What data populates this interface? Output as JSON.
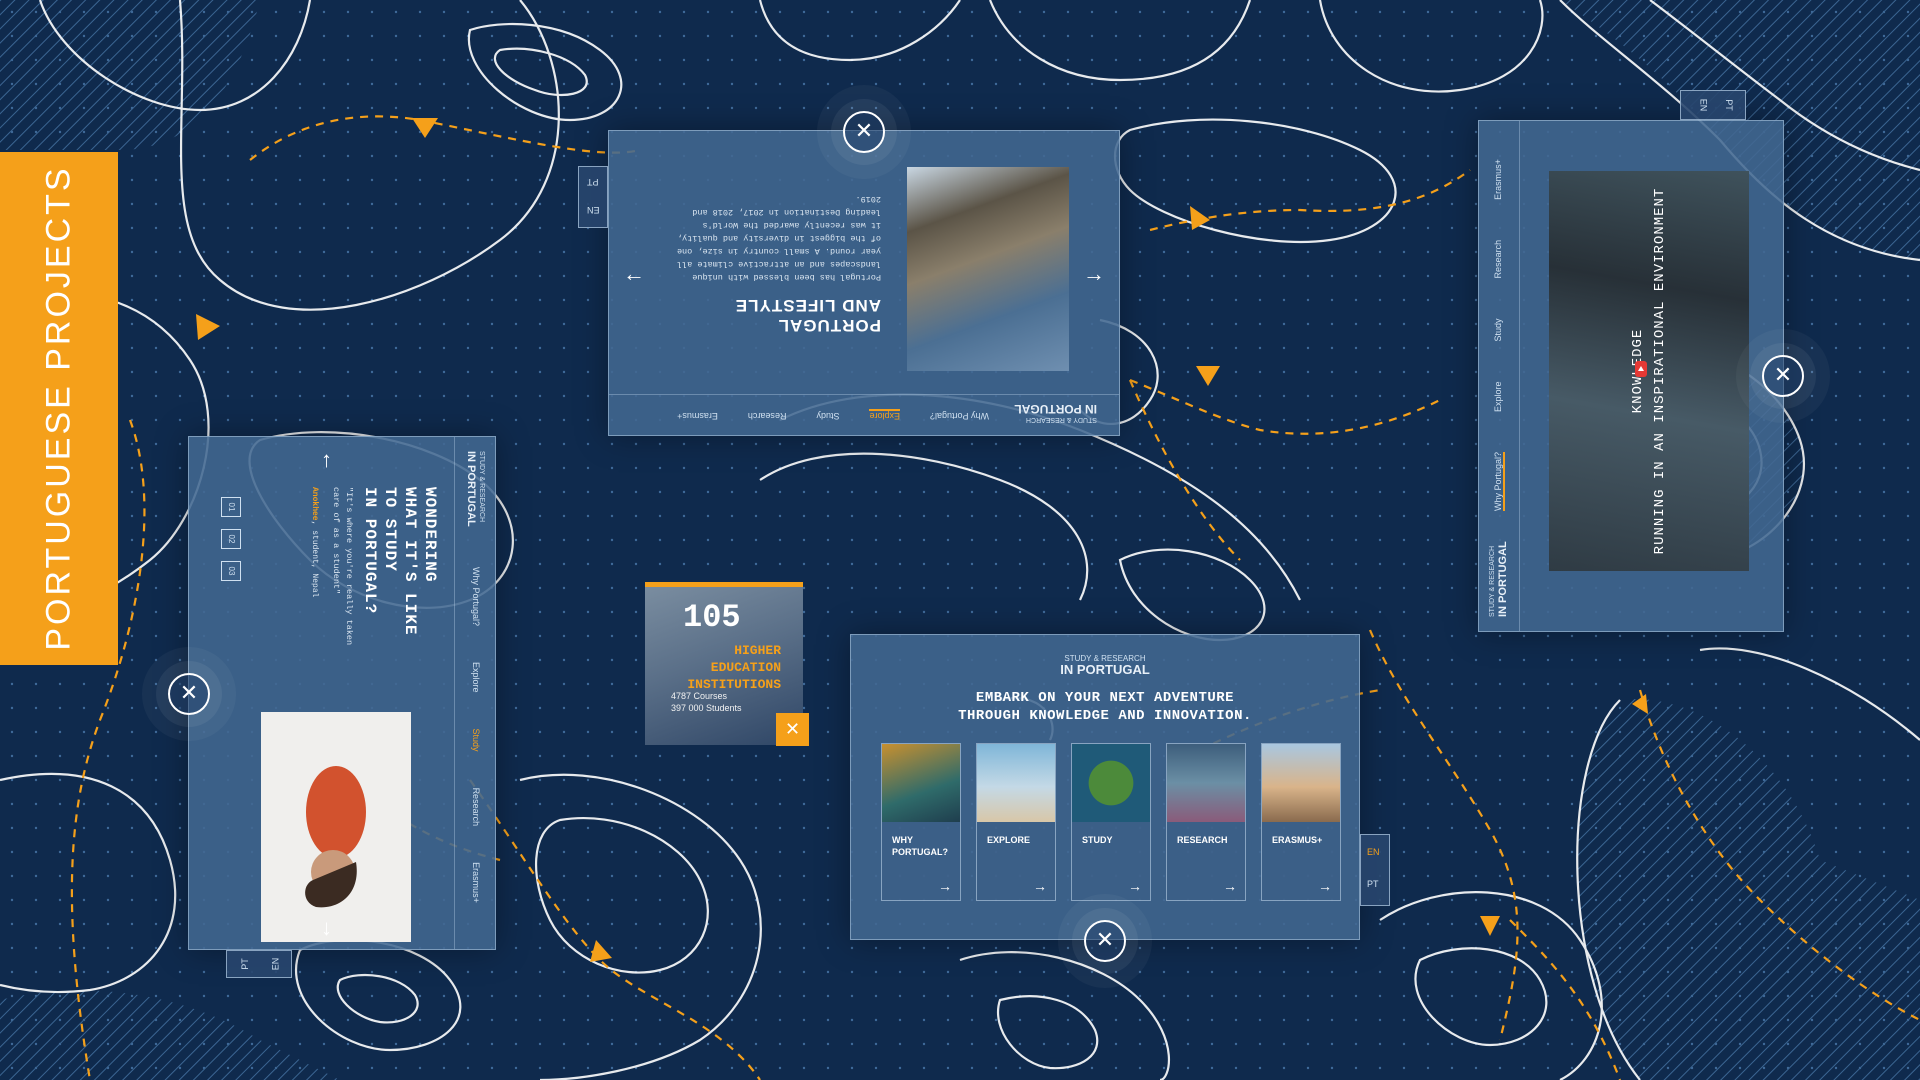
{
  "banner": {
    "title": "PORTUGUESE PROJECTS"
  },
  "brand": {
    "small": "STUDY & RESEARCH",
    "main": "IN PORTUGAL"
  },
  "lang": {
    "en": "EN",
    "pt": "PT"
  },
  "nav": [
    "Why Portugal?",
    "Explore",
    "Study",
    "Research",
    "Erasmus+"
  ],
  "panel_top": {
    "active_nav": "Explore",
    "title_line1": "PORTUGAL",
    "title_line2": "AND LIFESTYLE",
    "body": "Portugal has been blessed with unique landscapes and an attractive climate all year round. A small country in size, one of the biggest in diversity and quality, it was recently awarded the World's leading Destination in 2017, 2018 and 2019."
  },
  "panel_left": {
    "active_nav": "Study",
    "title_line1": "WONDERING",
    "title_line2": "WHAT IT'S LIKE",
    "title_line3": "TO STUDY",
    "title_line4": "IN PORTUGAL?",
    "quote": "\"It's where you're really taken care of as a student\"",
    "author_name": "Anokhee",
    "author_role": ", student, Nepal",
    "pagers": [
      "01",
      "02",
      "03"
    ]
  },
  "panel_right": {
    "active_nav": "Why Portugal?",
    "video_line1": "KNOWLEDGE",
    "video_line2": "RUNNING IN AN INSPIRATIONAL ENVIRONMENT"
  },
  "stat": {
    "number": "105",
    "label_line1": "HIGHER",
    "label_line2": "EDUCATION",
    "label_line3": "INSTITUTIONS",
    "sub_line1": "4787 Courses",
    "sub_line2": "397 000 Students",
    "close": "✕"
  },
  "panel_bottom": {
    "headline_line1": "EMBARK ON YOUR NEXT ADVENTURE",
    "headline_line2": "THROUGH KNOWLEDGE AND INNOVATION.",
    "cards": [
      {
        "label_line1": "WHY",
        "label_line2": "PORTUGAL?"
      },
      {
        "label_line1": "EXPLORE",
        "label_line2": ""
      },
      {
        "label_line1": "STUDY",
        "label_line2": ""
      },
      {
        "label_line1": "RESEARCH",
        "label_line2": ""
      },
      {
        "label_line1": "ERASMUS+",
        "label_line2": ""
      }
    ]
  },
  "icons": {
    "close": "✕",
    "arrow_left": "←",
    "arrow_right": "→",
    "arrow_up": "↑",
    "arrow_down": "↓"
  },
  "colors": {
    "background": "#0f2a4d",
    "accent": "#f5a01a",
    "panel": "#426891",
    "contour": "#ffffff"
  }
}
